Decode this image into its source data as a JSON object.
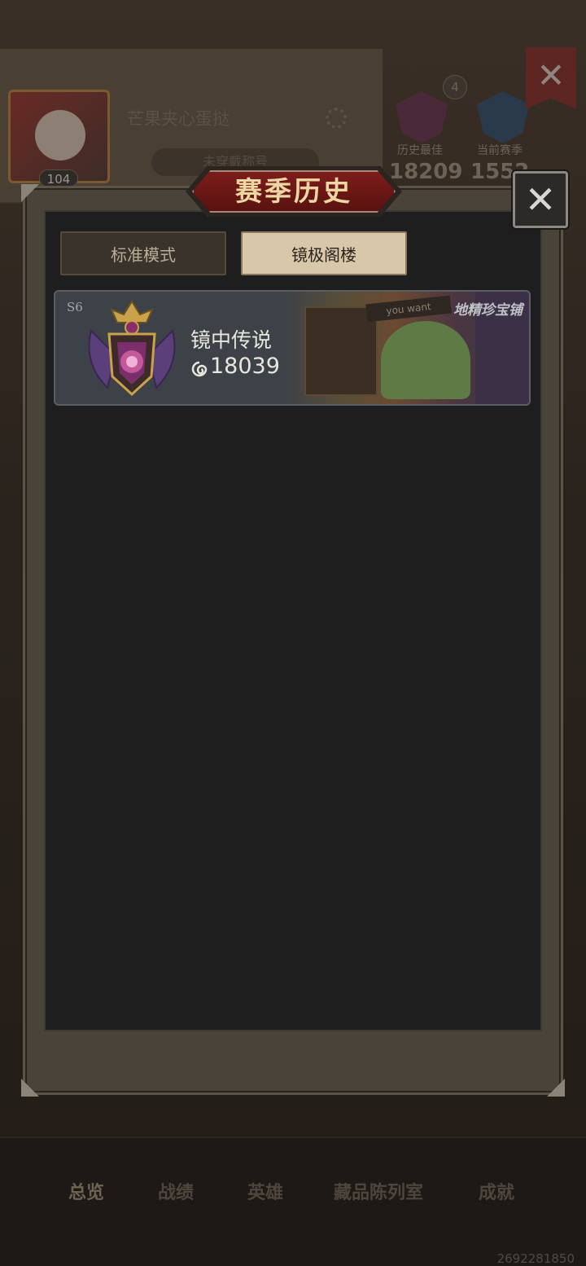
{
  "background_profile": {
    "player_name": "芒果夹心蛋挞",
    "level": "104",
    "title_button": "未穿戴称号",
    "best_label": "历史最佳",
    "best_value": "18209",
    "current_label": "当前赛季",
    "current_value": "1552",
    "badge_count": "4",
    "tabs": [
      "总览",
      "战绩",
      "英雄",
      "藏品陈列室",
      "成就"
    ],
    "uid": "2692281850"
  },
  "modal": {
    "title": "赛季历史",
    "tabs": [
      {
        "label": "标准模式",
        "active": false
      },
      {
        "label": "镜极阁楼",
        "active": true
      }
    ],
    "seasons": [
      {
        "season": "S6",
        "rank_name": "镜中传说",
        "score": "18039",
        "banner_label": "地精珍宝铺",
        "sign_text": "you want"
      }
    ]
  },
  "colors": {
    "title_plate": "#7c1d1a",
    "title_text": "#ecd6a3",
    "active_tab": "#d8c7a8",
    "inactive_tab": "#3a332b",
    "panel": "#1e1e1e"
  },
  "icons": {
    "close": "close-icon",
    "settings": "gear-icon",
    "rank": "mirror-legend-rank-icon",
    "score": "swirl-score-icon"
  }
}
